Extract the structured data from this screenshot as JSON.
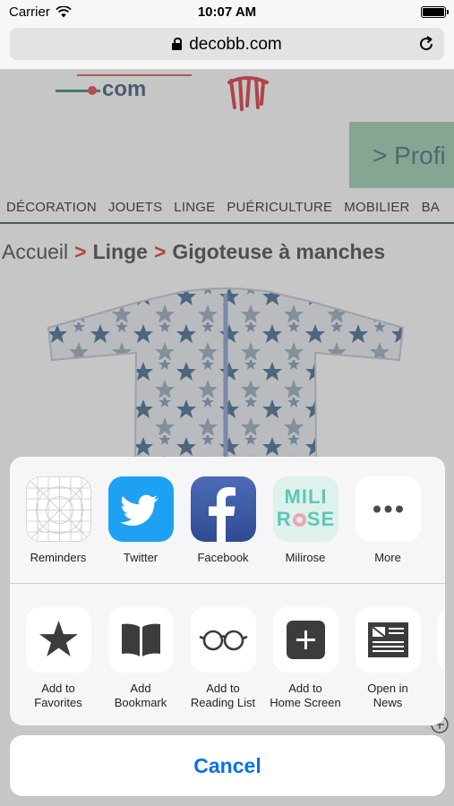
{
  "status_bar": {
    "carrier": "Carrier",
    "time": "10:07 AM",
    "battery_level": 1.0
  },
  "address_bar": {
    "url": "decobb.com"
  },
  "webpage": {
    "logo_text": "com",
    "profile_text": "> Profi",
    "nav_menu": [
      "DÉCORATION",
      "JOUETS",
      "LINGE",
      "PUÉRICULTURE",
      "MOBILIER",
      "BA"
    ],
    "breadcrumb": {
      "home": "Accueil",
      "separator": ">",
      "category": "Linge",
      "product": "Gigoteuse à manches"
    }
  },
  "share_sheet": {
    "apps": [
      {
        "label": "Reminders",
        "icon": "reminders-icon"
      },
      {
        "label": "Twitter",
        "icon": "twitter-icon"
      },
      {
        "label": "Facebook",
        "icon": "facebook-icon"
      },
      {
        "label": "Milirose",
        "icon": "milirose-icon",
        "logo_line1": "MILI",
        "logo_line2_a": "R",
        "logo_line2_b": "SE"
      },
      {
        "label": "More",
        "icon": "more-icon"
      }
    ],
    "actions": [
      {
        "label_line1": "Add to",
        "label_line2": "Favorites",
        "icon": "star-icon"
      },
      {
        "label_line1": "Add",
        "label_line2": "Bookmark",
        "icon": "book-icon"
      },
      {
        "label_line1": "Add to",
        "label_line2": "Reading List",
        "icon": "glasses-icon"
      },
      {
        "label_line1": "Add to",
        "label_line2": "Home Screen",
        "icon": "add-square-icon"
      },
      {
        "label_line1": "Open in",
        "label_line2": "News",
        "icon": "news-icon"
      }
    ]
  },
  "cancel_label": "Cancel",
  "colors": {
    "accent": "#0a70ec",
    "twitter": "#1ea1f2",
    "facebook": "#3b5998",
    "milirose_teal": "#5ec6b8",
    "milirose_pink": "#f2a3b4"
  }
}
